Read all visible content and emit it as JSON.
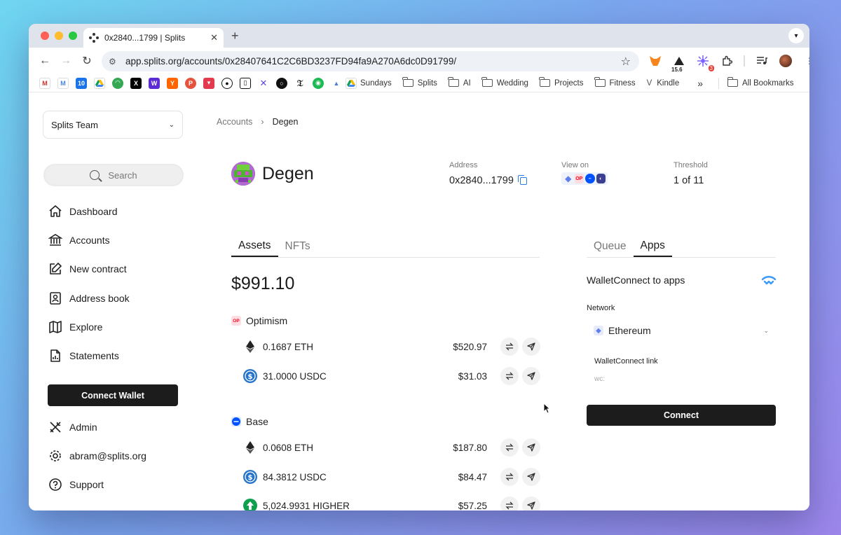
{
  "browser": {
    "tab_title": "0x2840...1799 | Splits",
    "url": "app.splits.org/accounts/0x28407641C2C6BD3237FD94fa9A270A6dc0D91799/",
    "ext_badge_count": "3",
    "ext_label": "15.6",
    "bookmarks": [
      "Sundays",
      "Splits",
      "AI",
      "Wedding",
      "Projects",
      "Fitness",
      "Kindle"
    ],
    "all_bookmarks": "All Bookmarks",
    "overflow": "»"
  },
  "sidebar": {
    "team": "Splits Team",
    "search_placeholder": "Search",
    "items": [
      {
        "label": "Dashboard",
        "icon": "home-icon"
      },
      {
        "label": "Accounts",
        "icon": "bank-icon"
      },
      {
        "label": "New contract",
        "icon": "edit-icon"
      },
      {
        "label": "Address book",
        "icon": "contacts-icon"
      },
      {
        "label": "Explore",
        "icon": "map-icon"
      },
      {
        "label": "Statements",
        "icon": "document-chart-icon"
      }
    ],
    "connect_wallet": "Connect Wallet",
    "bottom_items": [
      {
        "label": "Admin",
        "icon": "tools-icon"
      },
      {
        "label": "abram@splits.org",
        "icon": "gear-icon"
      },
      {
        "label": "Support",
        "icon": "help-icon"
      }
    ]
  },
  "breadcrumb": {
    "parent": "Accounts",
    "sep": "›",
    "current": "Degen"
  },
  "account": {
    "name": "Degen",
    "address_label": "Address",
    "address": "0x2840...1799",
    "view_on_label": "View on",
    "threshold_label": "Threshold",
    "threshold": "1 of 11"
  },
  "assets_tabs": [
    "Assets",
    "NFTs"
  ],
  "total": "$991.10",
  "chains": [
    {
      "name": "Optimism",
      "assets": [
        {
          "amount": "0.1687 ETH",
          "usd": "$520.97",
          "icon": "eth-icon"
        },
        {
          "amount": "31.0000 USDC",
          "usd": "$31.03",
          "icon": "usdc-icon"
        }
      ]
    },
    {
      "name": "Base",
      "assets": [
        {
          "amount": "0.0608 ETH",
          "usd": "$187.80",
          "icon": "eth-icon"
        },
        {
          "amount": "84.3812 USDC",
          "usd": "$84.47",
          "icon": "usdc-icon"
        },
        {
          "amount": "5,024.9931 HIGHER",
          "usd": "$57.25",
          "icon": "higher-icon"
        }
      ]
    }
  ],
  "right_tabs": [
    "Queue",
    "Apps"
  ],
  "walletconnect": {
    "title": "WalletConnect to apps",
    "network_label": "Network",
    "network": "Ethereum",
    "link_label": "WalletConnect link",
    "link_placeholder": "wc:",
    "connect": "Connect"
  },
  "colors": {
    "accent": "#1c1c1c",
    "link_blue": "#2a7de1",
    "op_red": "#ff0420",
    "base_blue": "#0052ff",
    "usdc_blue": "#2775ca",
    "higher_green": "#0e9f4f"
  }
}
